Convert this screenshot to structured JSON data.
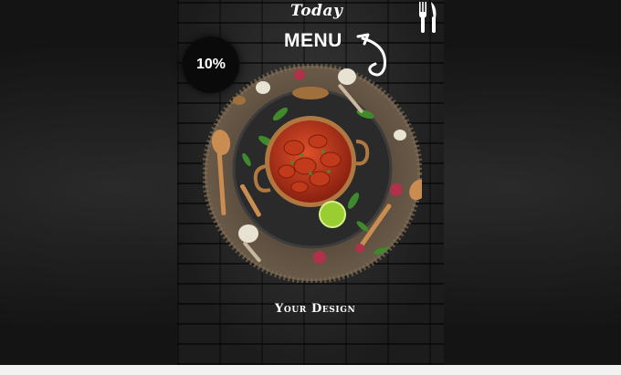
{
  "poster": {
    "heading_script": "Today",
    "heading_main": "MENU",
    "discount": "10%",
    "footer": "Your Design"
  },
  "icons": {
    "cutlery": "fork-and-knife-icon",
    "arrow": "curved-arrow-icon"
  },
  "colors": {
    "background": "#161616",
    "poster_wall": "#1e1e1e",
    "text": "#ffffff",
    "dish_sauce": "#b8321c",
    "pot_copper": "#b07840",
    "herb_green": "#3f8a2c",
    "lime": "#9acd32"
  }
}
